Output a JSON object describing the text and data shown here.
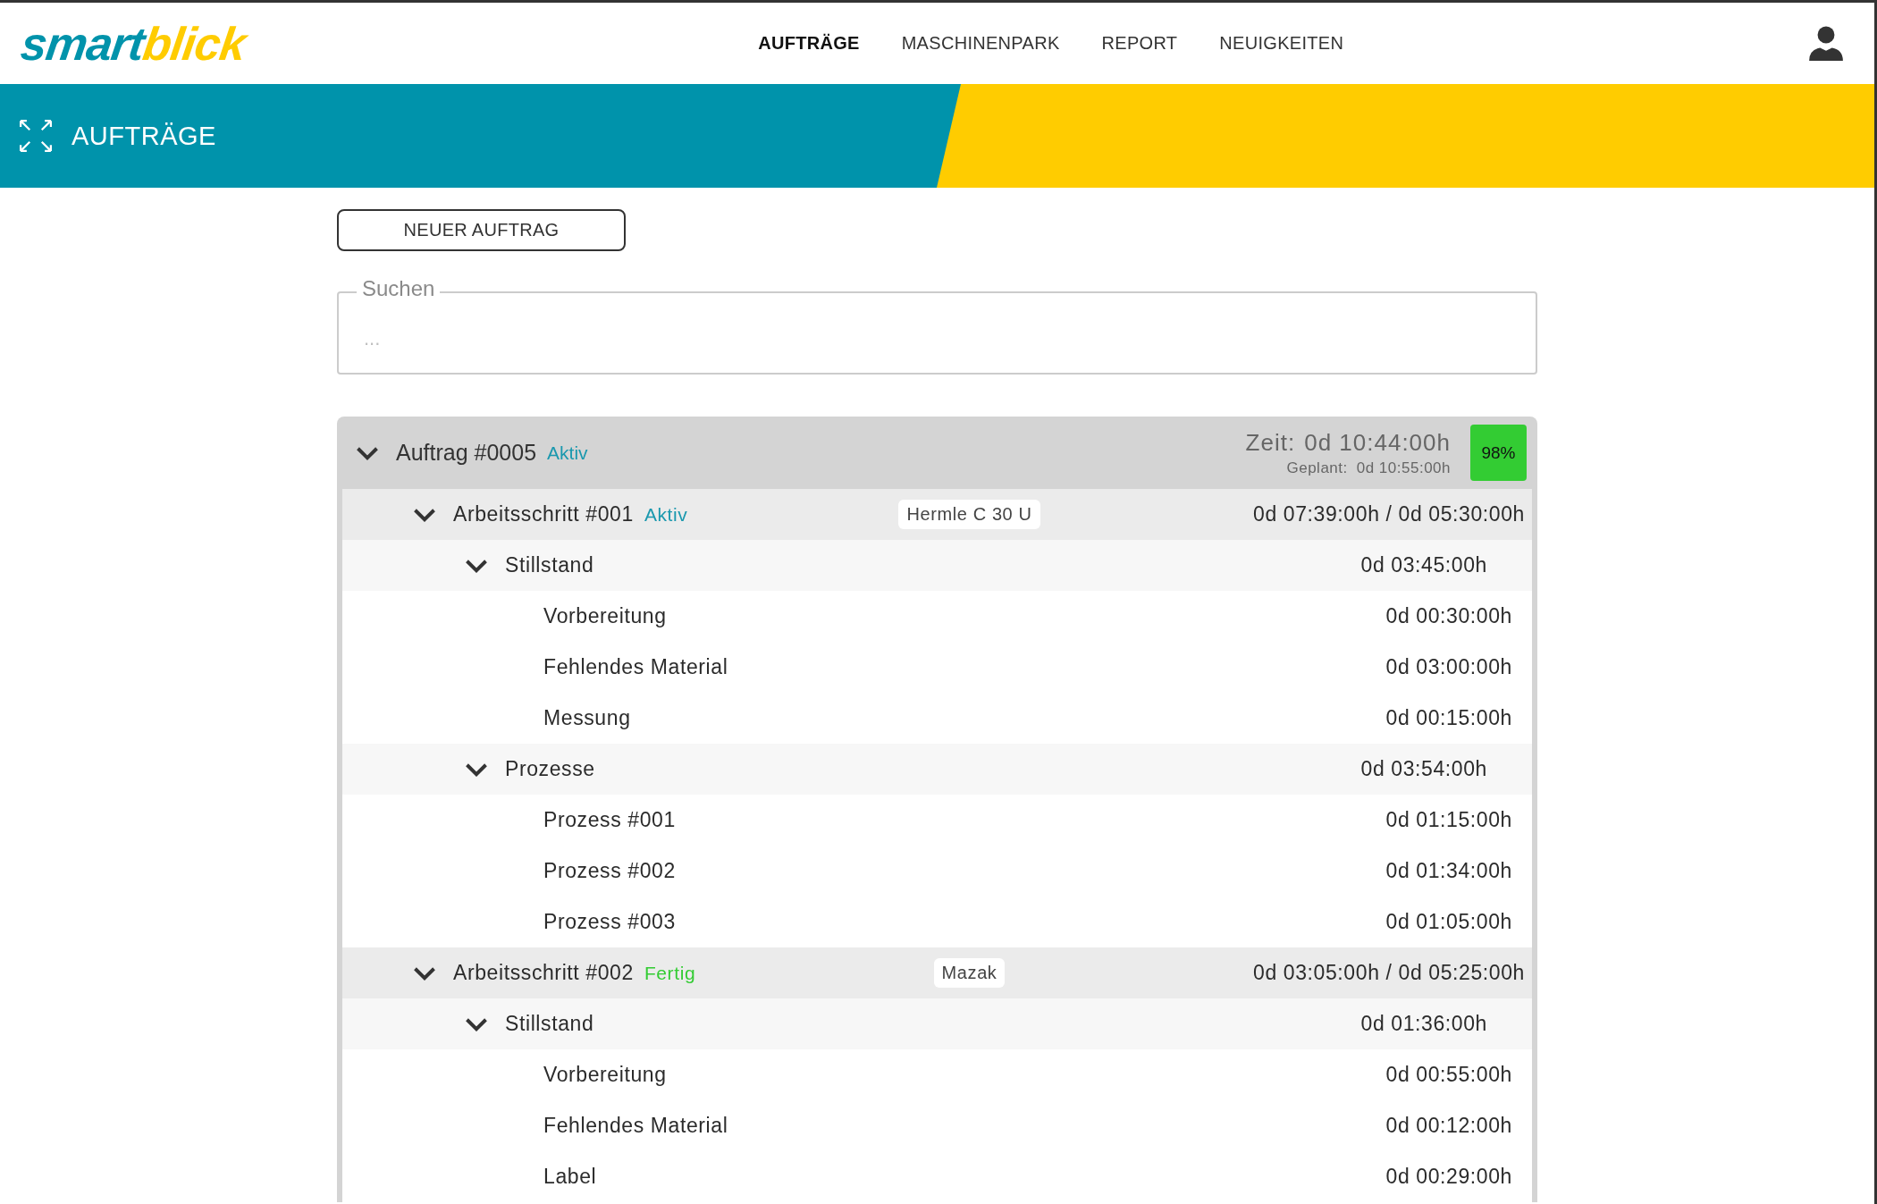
{
  "logo": {
    "first": "smart",
    "second": "blick"
  },
  "nav": [
    {
      "label": "AUFTRÄGE",
      "selected": true
    },
    {
      "label": "MASCHINENPARK",
      "selected": false
    },
    {
      "label": "REPORT",
      "selected": false
    },
    {
      "label": "NEUIGKEITEN",
      "selected": false
    }
  ],
  "banner": {
    "title": "AUFTRÄGE"
  },
  "new_button": "NEUER AUFTRAG",
  "search": {
    "label": "Suchen",
    "placeholder": "..."
  },
  "order": {
    "title": "Auftrag #0005",
    "status": "Aktiv",
    "color": "#1a98ae",
    "expanded": true,
    "time_label": "Zeit:",
    "time": "0d 10:44:00h",
    "planned_label": "Geplant:",
    "planned": "0d 10:55:00h",
    "percent": "98%",
    "children": [
      {
        "title": "Arbeitsschritt #001",
        "status": "Aktiv",
        "color": "#1a98ae",
        "machine": "Hermle C 30 U",
        "time": "0d 07:39:00h / 0d 05:30:00h",
        "expanded": true,
        "children": [
          {
            "title": "Stillstand",
            "time": "0d 03:45:00h",
            "expanded": true,
            "children": [
              {
                "title": "Vorbereitung",
                "time": "0d 00:30:00h"
              },
              {
                "title": "Fehlendes Material",
                "time": "0d 03:00:00h"
              },
              {
                "title": "Messung",
                "time": "0d 00:15:00h"
              }
            ]
          },
          {
            "title": "Prozesse",
            "time": "0d 03:54:00h",
            "expanded": true,
            "children": [
              {
                "title": "Prozess #001",
                "time": "0d 01:15:00h"
              },
              {
                "title": "Prozess #002",
                "time": "0d 01:34:00h"
              },
              {
                "title": "Prozess #003",
                "time": "0d 01:05:00h"
              }
            ]
          }
        ]
      },
      {
        "title": "Arbeitsschritt #002",
        "status": "Fertig",
        "color": "#33cc33",
        "machine": "Mazak",
        "time": "0d 03:05:00h / 0d 05:25:00h",
        "expanded": true,
        "children": [
          {
            "title": "Stillstand",
            "time": "0d 01:36:00h",
            "expanded": true,
            "children": [
              {
                "title": "Vorbereitung",
                "time": "0d 00:55:00h"
              },
              {
                "title": "Fehlendes Material",
                "time": "0d 00:12:00h"
              },
              {
                "title": "Label",
                "time": "0d 00:29:00h"
              }
            ]
          }
        ]
      }
    ]
  }
}
